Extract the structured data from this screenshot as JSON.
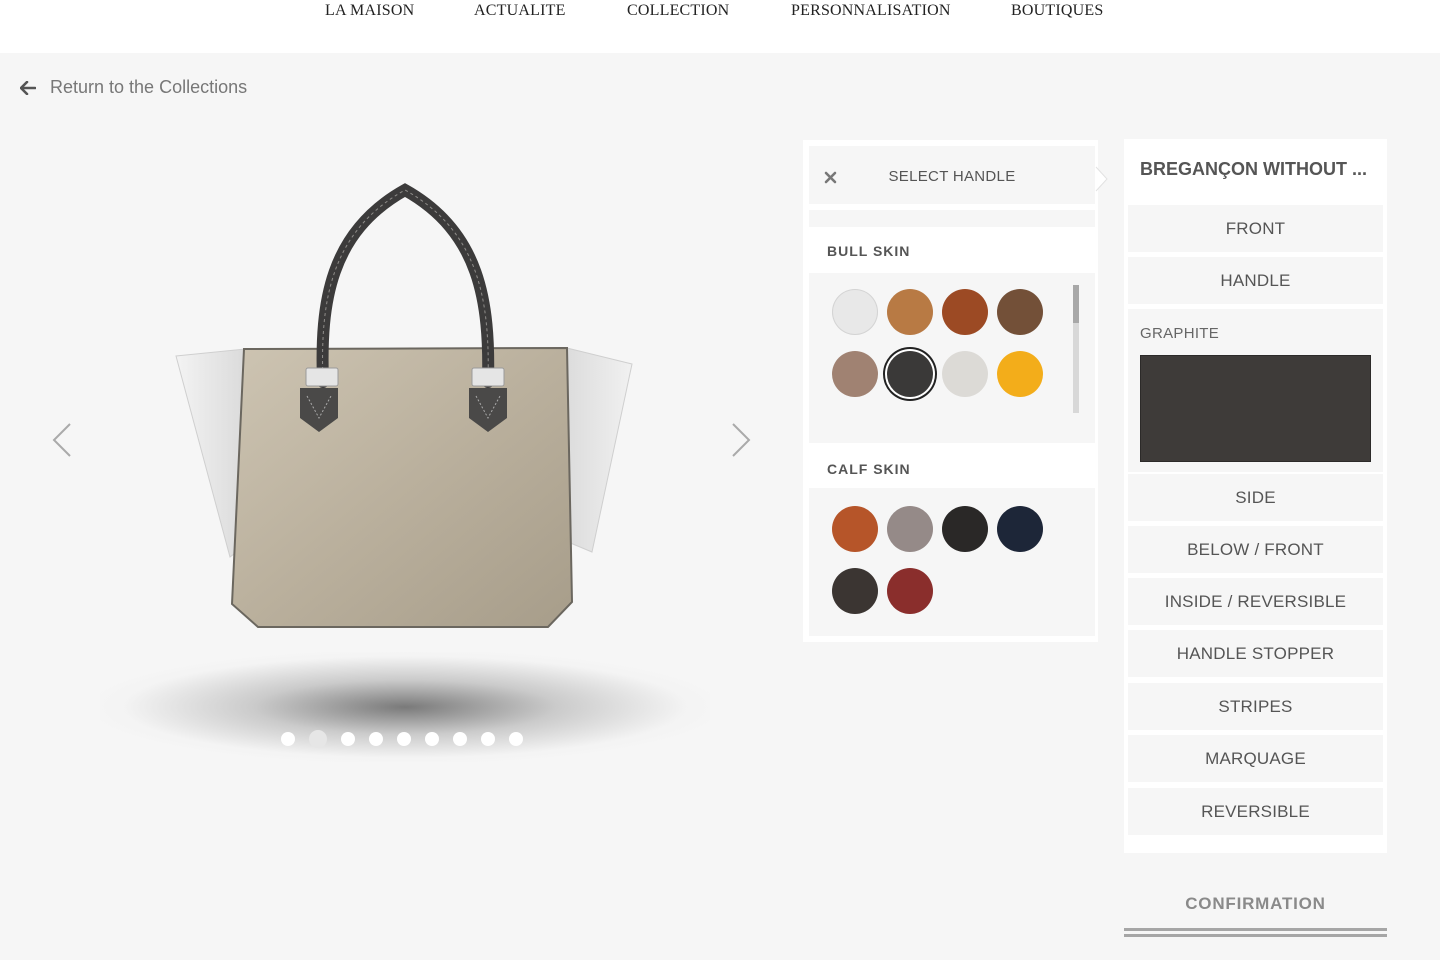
{
  "nav": {
    "items": [
      "LA MAISON",
      "ACTUALITE",
      "COLLECTION",
      "PERSONNALISATION",
      "BOUTIQUES"
    ]
  },
  "back": {
    "label": "Return to the Collections",
    "icon": "arrow-left-icon"
  },
  "carousel": {
    "prev_icon": "chevron-left-icon",
    "next_icon": "chevron-right-icon",
    "slide_count": 9,
    "active_slide": 2
  },
  "selector": {
    "title": "SELECT HANDLE",
    "close_icon": "close-icon",
    "sections": [
      {
        "name": "BULL SKIN",
        "swatches": [
          "#e8e8e8",
          "#b87a44",
          "#9c4a24",
          "#735038",
          "#a08272",
          "#3a3938",
          "#dcdad6",
          "#f3ad1a"
        ],
        "selected_index": 5
      },
      {
        "name": "CALF SKIN",
        "swatches": [
          "#b65529",
          "#958a88",
          "#2a2827",
          "#1d2638",
          "#3b3532",
          "#8a2e2c"
        ]
      }
    ]
  },
  "parts": {
    "header": "BREGANÇON WITHOUT ...",
    "items": [
      "FRONT",
      "HANDLE",
      "SIDE",
      "BELOW / FRONT",
      "INSIDE / REVERSIBLE",
      "HANDLE STOPPER",
      "STRIPES",
      "MARQUAGE",
      "REVERSIBLE"
    ],
    "current_material": "GRAPHITE",
    "current_material_color": "#3e3b39"
  },
  "confirm": {
    "label": "CONFIRMATION"
  }
}
